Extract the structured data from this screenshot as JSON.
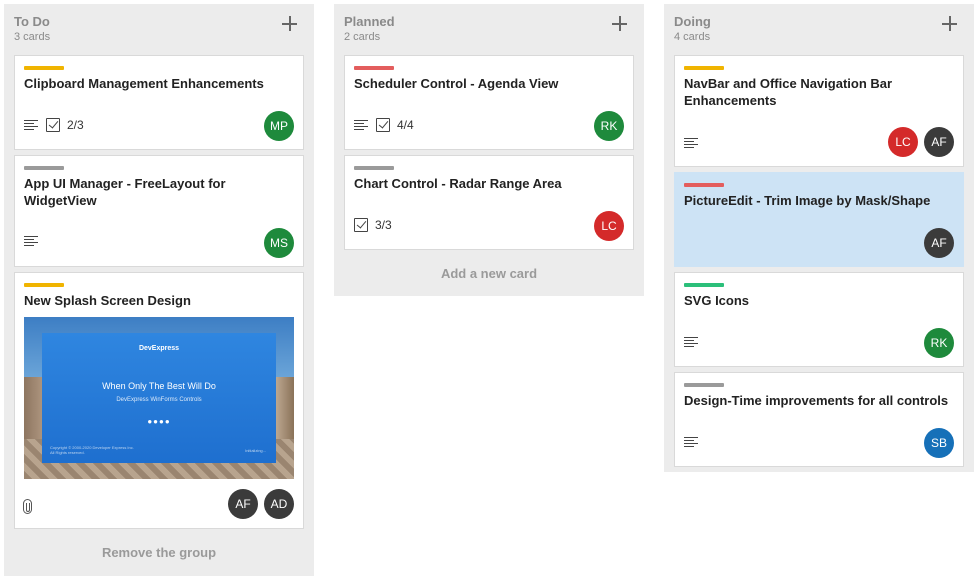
{
  "colors": {
    "tag_orange": "#f0b400",
    "tag_gray": "#9a9a9a",
    "tag_red": "#e35d5d",
    "tag_green": "#2bbf7a",
    "avatar_green": "#1e8a3c",
    "avatar_red": "#d42a2a",
    "avatar_dark": "#3b3b3b",
    "avatar_blue": "#1670b8",
    "selected_card": "#cde3f5"
  },
  "columns": [
    {
      "title": "To Do",
      "count": "3 cards",
      "footer": "Remove the group",
      "cards": [
        {
          "title": "Clipboard Management Enhancements",
          "tag": "tag_orange",
          "checklist": "2/3",
          "has_description": true,
          "avatars": [
            "MP"
          ]
        },
        {
          "title": "App UI Manager - FreeLayout for WidgetView",
          "tag": "tag_gray",
          "has_description": true,
          "avatars": [
            "MS"
          ]
        },
        {
          "title": "New Splash Screen Design",
          "tag": "tag_orange",
          "has_attachment": true,
          "avatars": [
            "AF",
            "AD"
          ],
          "image": {
            "brand": "DevExpress",
            "tagline": "When Only The Best Will Do",
            "product": "DevExpress WinForms Controls",
            "copyright_1": "Copyright © 2000-2020 Developer Express Inc.",
            "copyright_2": "All Rights reserved.",
            "status": "Initializing..."
          }
        }
      ]
    },
    {
      "title": "Planned",
      "count": "2 cards",
      "footer": "Add a new card",
      "cards": [
        {
          "title": "Scheduler Control - Agenda View",
          "tag": "tag_red",
          "checklist": "4/4",
          "has_description": true,
          "avatars": [
            "RK"
          ]
        },
        {
          "title": "Chart Control - Radar Range Area",
          "tag": "tag_gray",
          "checklist": "3/3",
          "avatars": [
            "LC"
          ]
        }
      ]
    },
    {
      "title": "Doing",
      "count": "4 cards",
      "cards": [
        {
          "title": "NavBar and Office Navigation Bar Enhancements",
          "tag": "tag_orange",
          "has_description": true,
          "avatars": [
            "LC",
            "AF"
          ]
        },
        {
          "title": "PictureEdit - Trim Image by Mask/Shape",
          "tag": "tag_red",
          "selected": true,
          "avatars": [
            "AF"
          ]
        },
        {
          "title": "SVG Icons",
          "tag": "tag_green",
          "has_description": true,
          "avatars": [
            "RK"
          ]
        },
        {
          "title": "Design-Time improvements for all controls",
          "tag": "tag_gray",
          "has_description": true,
          "avatars": [
            "SB"
          ]
        }
      ]
    }
  ]
}
